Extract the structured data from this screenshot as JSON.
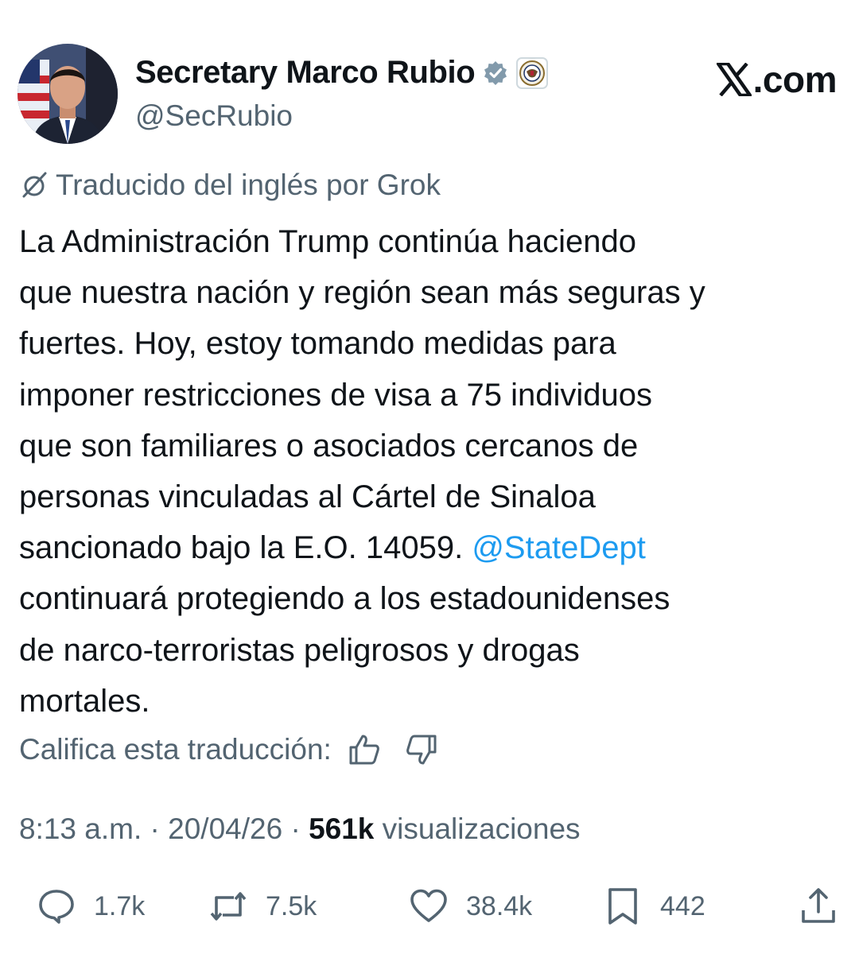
{
  "user": {
    "display_name": "Secretary Marco Rubio",
    "handle": "@SecRubio",
    "avatar": "avatar",
    "badges": [
      "verified-check-icon",
      "department-seal-icon"
    ]
  },
  "brand": {
    "logo": "x-logo-icon",
    "suffix": ".com"
  },
  "translation": {
    "note": "Traducido del inglés por Grok",
    "icon": "grok-icon"
  },
  "tweet": {
    "lines": [
      "La Administración Trump continúa haciendo",
      "que nuestra nación y región sean más seguras y",
      "fuertes. Hoy, estoy tomando medidas para",
      "imponer restricciones de visa a 75 individuos",
      "que son familiares o asociados cercanos de",
      "personas vinculadas al Cártel de Sinaloa",
      "sancionado bajo la E.O. 14059."
    ],
    "mention": "@StateDept",
    "lines_after": [
      "continuará protegiendo a los estadounidenses",
      "de narco-terroristas peligrosos y drogas",
      "mortales."
    ]
  },
  "rating": {
    "label": "Califica esta traducción:"
  },
  "meta": {
    "time": "8:13 a.m.",
    "separator": "·",
    "date": "20/04/26",
    "views_count": "561k",
    "views_label": "visualizaciones"
  },
  "actions": {
    "replies": "1.7k",
    "reposts": "7.5k",
    "likes": "38.4k",
    "bookmarks": "442"
  },
  "colors": {
    "text": "#0f1419",
    "secondary": "#536471",
    "link": "#1d9bf0",
    "verified": "#829aab"
  }
}
